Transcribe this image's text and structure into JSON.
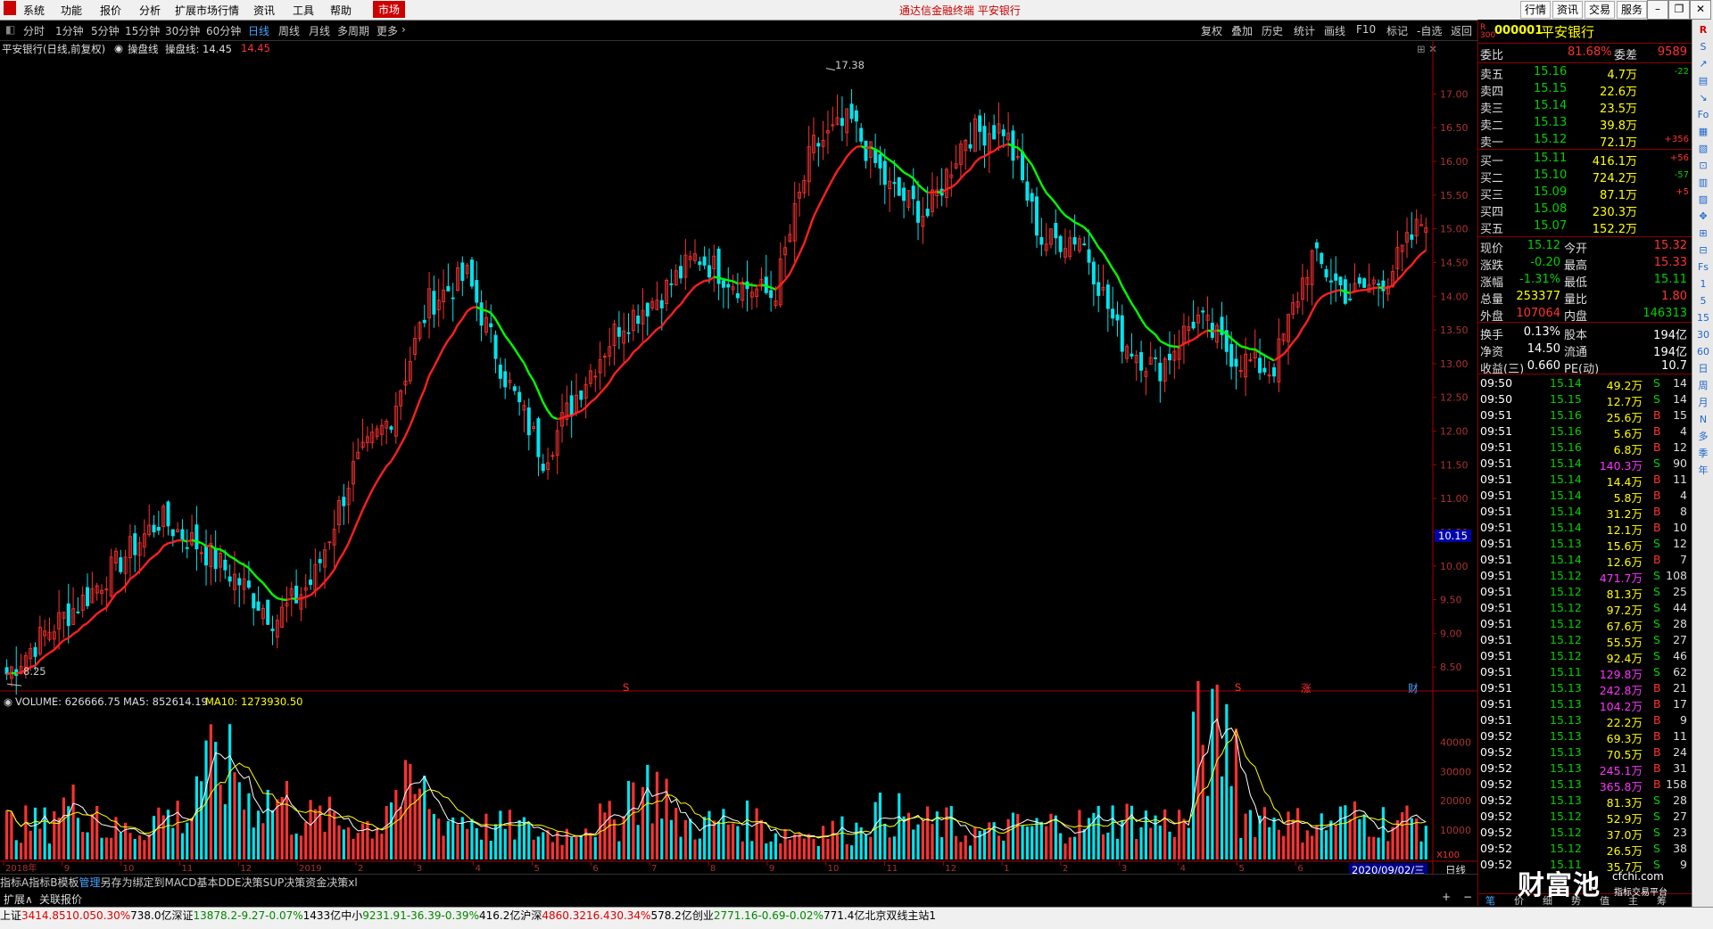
{
  "menubar": {
    "items": [
      "系统",
      "功能",
      "报价",
      "分析",
      "扩展市场行情",
      "资讯",
      "工具",
      "帮助"
    ],
    "market": "市场",
    "title": "通达信金融终端  平安银行",
    "right_buttons": [
      "行情",
      "资讯",
      "交易",
      "服务"
    ]
  },
  "toolbar": {
    "periods": [
      "分时",
      "1分钟",
      "5分钟",
      "15分钟",
      "30分钟",
      "60分钟",
      "日线",
      "周线",
      "月线",
      "多周期",
      "更多"
    ],
    "active": "日线",
    "tools": [
      "复权",
      "叠加",
      "历史",
      "统计",
      "画线",
      "F10",
      "标记",
      "-自选",
      "返回"
    ]
  },
  "chart_info": {
    "stock": "平安银行(日线,前复权)",
    "indicator": "操盘线",
    "indicator_value": "操盘线: 14.45",
    "value2": "14.45",
    "high_label": "17.38",
    "low_label": "8.25",
    "price_tag": "10.15",
    "markers": [
      "S",
      "S",
      "涨",
      "财"
    ],
    "volume_info": "VOLUME: 626666.75",
    "ma5_info": "MA5: 852614.19",
    "ma10_info": "MA10: 1273930.50",
    "date_tag": "2020/09/02/三",
    "period_btn": "日线",
    "vol_unit": "X100"
  },
  "chart_data": {
    "type": "line",
    "price_axis": [
      "17.00",
      "16.50",
      "16.00",
      "15.50",
      "15.00",
      "14.50",
      "14.00",
      "13.50",
      "13.00",
      "12.50",
      "12.00",
      "11.50",
      "11.00",
      "10.50",
      "10.00",
      "9.50",
      "9.00",
      "8.50"
    ],
    "volume_axis": [
      "40000",
      "30000",
      "20000",
      "10000"
    ],
    "x_labels": [
      "2018年",
      "9",
      "10",
      "11",
      "12",
      "2019",
      "2",
      "3",
      "4",
      "5",
      "6",
      "7",
      "8",
      "9",
      "10",
      "11",
      "12",
      "1",
      "2",
      "3",
      "4",
      "5",
      "6",
      "7"
    ],
    "ylim": [
      8.0,
      17.6
    ],
    "close_points": [
      8.4,
      9.0,
      9.5,
      10.1,
      10.7,
      10.3,
      9.8,
      9.2,
      9.8,
      11.4,
      12.2,
      13.9,
      14.3,
      12.8,
      11.6,
      12.7,
      13.6,
      14.0,
      14.6,
      14.2,
      14.0,
      16.2,
      16.6,
      15.6,
      15.2,
      16.4,
      16.5,
      14.8,
      14.9,
      13.4,
      12.9,
      13.7,
      13.1,
      12.9,
      14.6,
      14.0,
      14.3,
      15.2
    ],
    "high": 17.38,
    "low": 8.25,
    "volume_series_k": [
      12,
      18,
      10,
      15,
      30,
      20,
      14,
      12,
      22,
      14,
      11,
      9,
      13,
      24,
      12,
      13,
      9,
      10,
      15,
      12,
      9,
      11,
      12,
      14,
      13,
      40,
      15,
      12,
      14,
      13
    ]
  },
  "bottom_tabs": [
    "指标A",
    "指标B",
    "模板",
    "管理",
    "另存为",
    "绑定到",
    "MACD基本",
    "DDE决策",
    "SUP决策",
    "资金决策",
    "xl"
  ],
  "bottom_tabs2": [
    "扩展∧",
    "关联报价"
  ],
  "quote": {
    "code": "000001",
    "name": "平安银行",
    "weibi_label": "委比",
    "weibi": "81.68%",
    "weicha_label": "委差",
    "weicha": "9589",
    "asks": [
      {
        "label": "卖五",
        "price": "15.16",
        "vol": "4.7万",
        "chg": "-22"
      },
      {
        "label": "卖四",
        "price": "15.15",
        "vol": "22.6万",
        "chg": ""
      },
      {
        "label": "卖三",
        "price": "15.14",
        "vol": "23.5万",
        "chg": ""
      },
      {
        "label": "卖二",
        "price": "15.13",
        "vol": "39.8万",
        "chg": ""
      },
      {
        "label": "卖一",
        "price": "15.12",
        "vol": "72.1万",
        "chg": "+356"
      }
    ],
    "bids": [
      {
        "label": "买一",
        "price": "15.11",
        "vol": "416.1万",
        "chg": "+56"
      },
      {
        "label": "买二",
        "price": "15.10",
        "vol": "724.2万",
        "chg": "-57"
      },
      {
        "label": "买三",
        "price": "15.09",
        "vol": "87.1万",
        "chg": "+5"
      },
      {
        "label": "买四",
        "price": "15.08",
        "vol": "230.3万",
        "chg": ""
      },
      {
        "label": "买五",
        "price": "15.07",
        "vol": "152.2万",
        "chg": ""
      }
    ],
    "stats": [
      {
        "l1": "现价",
        "v1": "15.12",
        "l2": "今开",
        "v2": "15.32"
      },
      {
        "l1": "涨跌",
        "v1": "-0.20",
        "l2": "最高",
        "v2": "15.33"
      },
      {
        "l1": "涨幅",
        "v1": "-1.31%",
        "l2": "最低",
        "v2": "15.11"
      },
      {
        "l1": "总量",
        "v1": "253377",
        "l2": "量比",
        "v2": "1.80"
      },
      {
        "l1": "外盘",
        "v1": "107064",
        "l2": "内盘",
        "v2": "146313"
      },
      {
        "l1": "换手",
        "v1": "0.13%",
        "l2": "股本",
        "v2": "194亿"
      },
      {
        "l1": "净资",
        "v1": "14.50",
        "l2": "流通",
        "v2": "194亿"
      },
      {
        "l1": "收益(三)",
        "v1": "0.660",
        "l2": "PE(动)",
        "v2": "10.7"
      }
    ],
    "ticks": [
      {
        "t": "09:50",
        "p": "15.14",
        "v": "49.2万",
        "d": "S",
        "n": "14"
      },
      {
        "t": "09:50",
        "p": "15.15",
        "v": "12.7万",
        "d": "S",
        "n": "14"
      },
      {
        "t": "09:51",
        "p": "15.16",
        "v": "25.6万",
        "d": "B",
        "n": "15"
      },
      {
        "t": "09:51",
        "p": "15.16",
        "v": "5.6万",
        "d": "B",
        "n": "4"
      },
      {
        "t": "09:51",
        "p": "15.16",
        "v": "6.8万",
        "d": "B",
        "n": "12"
      },
      {
        "t": "09:51",
        "p": "15.14",
        "v": "140.3万",
        "d": "S",
        "n": "90"
      },
      {
        "t": "09:51",
        "p": "15.14",
        "v": "14.4万",
        "d": "B",
        "n": "11"
      },
      {
        "t": "09:51",
        "p": "15.14",
        "v": "5.8万",
        "d": "B",
        "n": "4"
      },
      {
        "t": "09:51",
        "p": "15.14",
        "v": "31.2万",
        "d": "B",
        "n": "8"
      },
      {
        "t": "09:51",
        "p": "15.14",
        "v": "12.1万",
        "d": "B",
        "n": "10"
      },
      {
        "t": "09:51",
        "p": "15.13",
        "v": "15.6万",
        "d": "S",
        "n": "12"
      },
      {
        "t": "09:51",
        "p": "15.14",
        "v": "12.6万",
        "d": "B",
        "n": "7"
      },
      {
        "t": "09:51",
        "p": "15.12",
        "v": "471.7万",
        "d": "S",
        "n": "108"
      },
      {
        "t": "09:51",
        "p": "15.12",
        "v": "81.3万",
        "d": "S",
        "n": "25"
      },
      {
        "t": "09:51",
        "p": "15.12",
        "v": "97.2万",
        "d": "S",
        "n": "44"
      },
      {
        "t": "09:51",
        "p": "15.12",
        "v": "67.6万",
        "d": "S",
        "n": "28"
      },
      {
        "t": "09:51",
        "p": "15.12",
        "v": "55.5万",
        "d": "S",
        "n": "27"
      },
      {
        "t": "09:51",
        "p": "15.12",
        "v": "92.4万",
        "d": "S",
        "n": "46"
      },
      {
        "t": "09:51",
        "p": "15.11",
        "v": "129.8万",
        "d": "S",
        "n": "62"
      },
      {
        "t": "09:51",
        "p": "15.13",
        "v": "242.8万",
        "d": "B",
        "n": "21"
      },
      {
        "t": "09:51",
        "p": "15.13",
        "v": "104.2万",
        "d": "B",
        "n": "17"
      },
      {
        "t": "09:51",
        "p": "15.13",
        "v": "22.2万",
        "d": "B",
        "n": "9"
      },
      {
        "t": "09:52",
        "p": "15.13",
        "v": "69.3万",
        "d": "B",
        "n": "11"
      },
      {
        "t": "09:52",
        "p": "15.13",
        "v": "70.5万",
        "d": "B",
        "n": "24"
      },
      {
        "t": "09:52",
        "p": "15.13",
        "v": "245.1万",
        "d": "B",
        "n": "31"
      },
      {
        "t": "09:52",
        "p": "15.13",
        "v": "365.8万",
        "d": "B",
        "n": "158"
      },
      {
        "t": "09:52",
        "p": "15.13",
        "v": "81.3万",
        "d": "S",
        "n": "28"
      },
      {
        "t": "09:52",
        "p": "15.12",
        "v": "52.9万",
        "d": "S",
        "n": "27"
      },
      {
        "t": "09:52",
        "p": "15.12",
        "v": "37.0万",
        "d": "S",
        "n": "23"
      },
      {
        "t": "09:52",
        "p": "15.12",
        "v": "26.5万",
        "d": "S",
        "n": "38"
      },
      {
        "t": "09:52",
        "p": "15.11",
        "v": "35.7万",
        "d": "S",
        "n": "9"
      }
    ],
    "bottom_tabs": [
      "笔",
      "价",
      "细",
      "势",
      "值",
      "主",
      "筹"
    ]
  },
  "sidebar_buttons": [
    "R",
    "S",
    "↗",
    "▤",
    "↘",
    "Fo",
    "▦",
    "▧",
    "⊡",
    "▥",
    "▨",
    "✥",
    "⊞",
    "⊟",
    "Fs",
    "1",
    "5",
    "15",
    "30",
    "60",
    "日",
    "周",
    "月",
    "N",
    "多",
    "季",
    "年"
  ],
  "watermark": {
    "brand": "财富池",
    "site": "cfchi.com",
    "slogan": "指标交易平台"
  },
  "statusbar": [
    {
      "name": "上证",
      "price": "3414.85",
      "chg": "10.05",
      "pct": "0.30%",
      "amt": "738.0亿"
    },
    {
      "name": "深证",
      "price": "13878.2",
      "chg": "-9.27",
      "pct": "-0.07%",
      "amt": "1433亿"
    },
    {
      "name": "中小",
      "price": "9231.91",
      "chg": "-36.39",
      "pct": "-0.39%",
      "amt": "416.2亿"
    },
    {
      "name": "沪深",
      "price": "4860.32",
      "chg": "16.43",
      "pct": "0.34%",
      "amt": "578.2亿"
    },
    {
      "name": "创业",
      "price": "2771.16",
      "chg": "-0.69",
      "pct": "-0.02%",
      "amt": "771.4亿"
    }
  ],
  "server": "北京双线主站1"
}
